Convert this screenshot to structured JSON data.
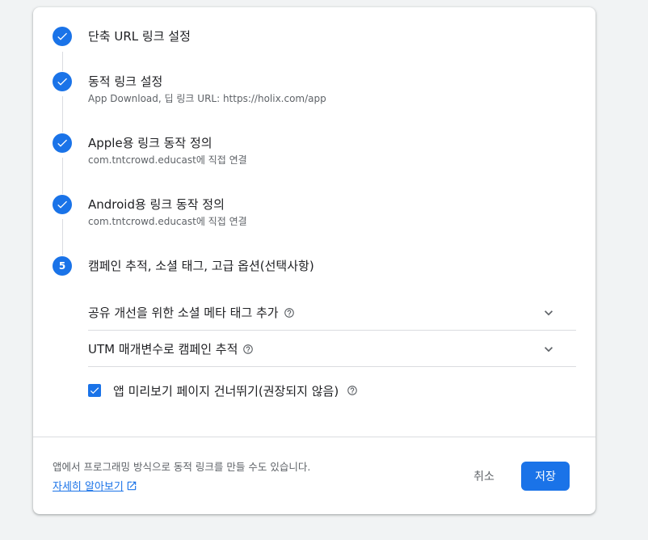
{
  "steps": [
    {
      "title": "단축 URL 링크 설정",
      "subtitle": "",
      "state": "done"
    },
    {
      "title": "동적 링크 설정",
      "subtitle": "App Download, 딥 링크 URL: https://holix.com/app",
      "state": "done"
    },
    {
      "title": "Apple용 링크 동작 정의",
      "subtitle": "com.tntcrowd.educast에 직접 연결",
      "state": "done"
    },
    {
      "title": "Android용 링크 동작 정의",
      "subtitle": "com.tntcrowd.educast에 직접 연결",
      "state": "done"
    },
    {
      "title": "캠페인 추적, 소셜 태그, 고급 옵션(선택사항)",
      "subtitle": "",
      "state": "active",
      "number": "5"
    }
  ],
  "step5": {
    "accordions": [
      {
        "label": "공유 개선을 위한 소셜 메타 태그 추가"
      },
      {
        "label": "UTM 매개변수로 캠페인 추적"
      }
    ],
    "checkbox": {
      "label": "앱 미리보기 페이지 건너뛰기(권장되지 않음)",
      "checked": true
    }
  },
  "footer": {
    "info_text": "앱에서 프로그래밍 방식으로 동적 링크를 만들 수도 있습니다.",
    "learn_more": "자세히 알아보기",
    "cancel_label": "취소",
    "save_label": "저장"
  },
  "colors": {
    "accent": "#1a73e8",
    "text_primary": "#202124",
    "text_secondary": "#5f6368",
    "divider": "#dadce0"
  },
  "icons": {
    "done": "check-icon",
    "help": "help-circle-icon",
    "expand": "chevron-down-icon",
    "external": "open-in-new-icon"
  }
}
